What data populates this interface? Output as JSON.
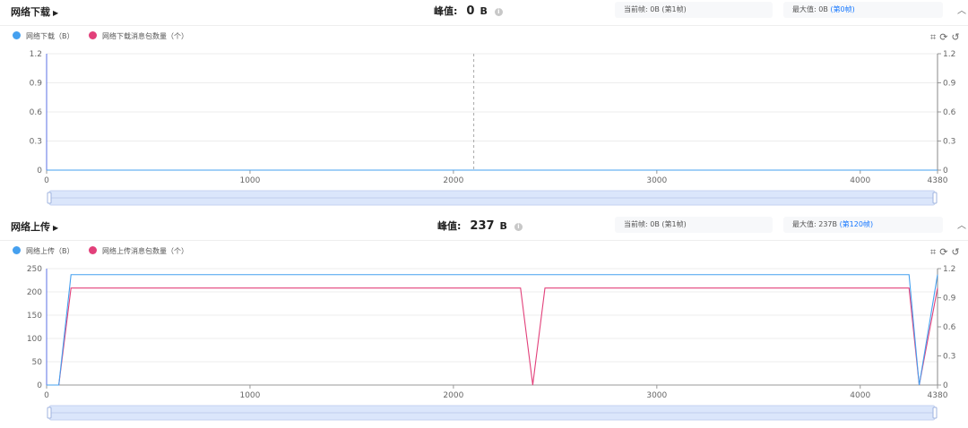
{
  "download": {
    "title": "网络下载",
    "peak_label": "峰值:",
    "peak_value": "0",
    "peak_unit": "B",
    "info_icon": "info-circle-icon",
    "current_label": "当前帧:",
    "current_value": "0B (第1帧)",
    "max_label": "最大值:",
    "max_value": "0B",
    "max_link": "(第0帧)",
    "legend": [
      "网络下载（B）",
      "网络下载消息包数量（个）"
    ]
  },
  "upload": {
    "title": "网络上传",
    "peak_label": "峰值:",
    "peak_value": "237",
    "peak_unit": "B",
    "info_icon": "info-circle-icon",
    "current_label": "当前帧:",
    "current_value": "0B (第1帧)",
    "max_label": "最大值:",
    "max_value": "237B",
    "max_link": "(第120帧)",
    "legend": [
      "网络上传（B）",
      "网络上传消息包数量（个）"
    ]
  },
  "toolbar_icons": [
    "crop-icon",
    "refresh-icon",
    "restore-icon"
  ],
  "colors": {
    "series_bytes": "#45a0ef",
    "series_packets": "#e2407a",
    "axis": "#5b72e6",
    "slider": "#dbe6fb"
  },
  "chart_data": [
    {
      "type": "line",
      "title": "网络下载",
      "xlim": [
        0,
        4380
      ],
      "x_ticks": [
        "0",
        "1000",
        "2000",
        "3000",
        "4000",
        "4380"
      ],
      "y_ticks_left": [
        "0",
        "0.3",
        "0.6",
        "0.9",
        "1.2"
      ],
      "y_ticks_right": [
        "0",
        "0.3",
        "0.6",
        "0.9",
        "1.2"
      ],
      "ylim_left": [
        0,
        1.2
      ],
      "ylim_right": [
        0,
        1.2
      ],
      "crosshair_x": 2100,
      "series": [
        {
          "name": "网络下载（B）",
          "axis": "left",
          "x": [
            0,
            4380
          ],
          "values": [
            0,
            0
          ]
        },
        {
          "name": "网络下载消息包数量（个）",
          "axis": "right",
          "x": [
            0,
            4380
          ],
          "values": [
            0,
            0
          ]
        }
      ]
    },
    {
      "type": "line",
      "title": "网络上传",
      "xlim": [
        0,
        4380
      ],
      "x_ticks": [
        "0",
        "1000",
        "2000",
        "3000",
        "4000",
        "4380"
      ],
      "y_ticks_left": [
        "0",
        "50",
        "100",
        "150",
        "200",
        "250"
      ],
      "y_ticks_right": [
        "0",
        "0.3",
        "0.6",
        "0.9",
        "1.2"
      ],
      "ylim_left": [
        0,
        250
      ],
      "ylim_right": [
        0,
        1.2
      ],
      "series": [
        {
          "name": "网络上传（B）",
          "axis": "left",
          "x": [
            0,
            60,
            120,
            4240,
            4290,
            4380
          ],
          "values": [
            0,
            0,
            237,
            237,
            0,
            237
          ]
        },
        {
          "name": "网络上传消息包数量（个）",
          "axis": "right",
          "x": [
            0,
            60,
            120,
            2330,
            2390,
            2450,
            4240,
            4290,
            4380
          ],
          "values": [
            0,
            0,
            1,
            1,
            0,
            1,
            1,
            0,
            1
          ]
        }
      ]
    }
  ]
}
